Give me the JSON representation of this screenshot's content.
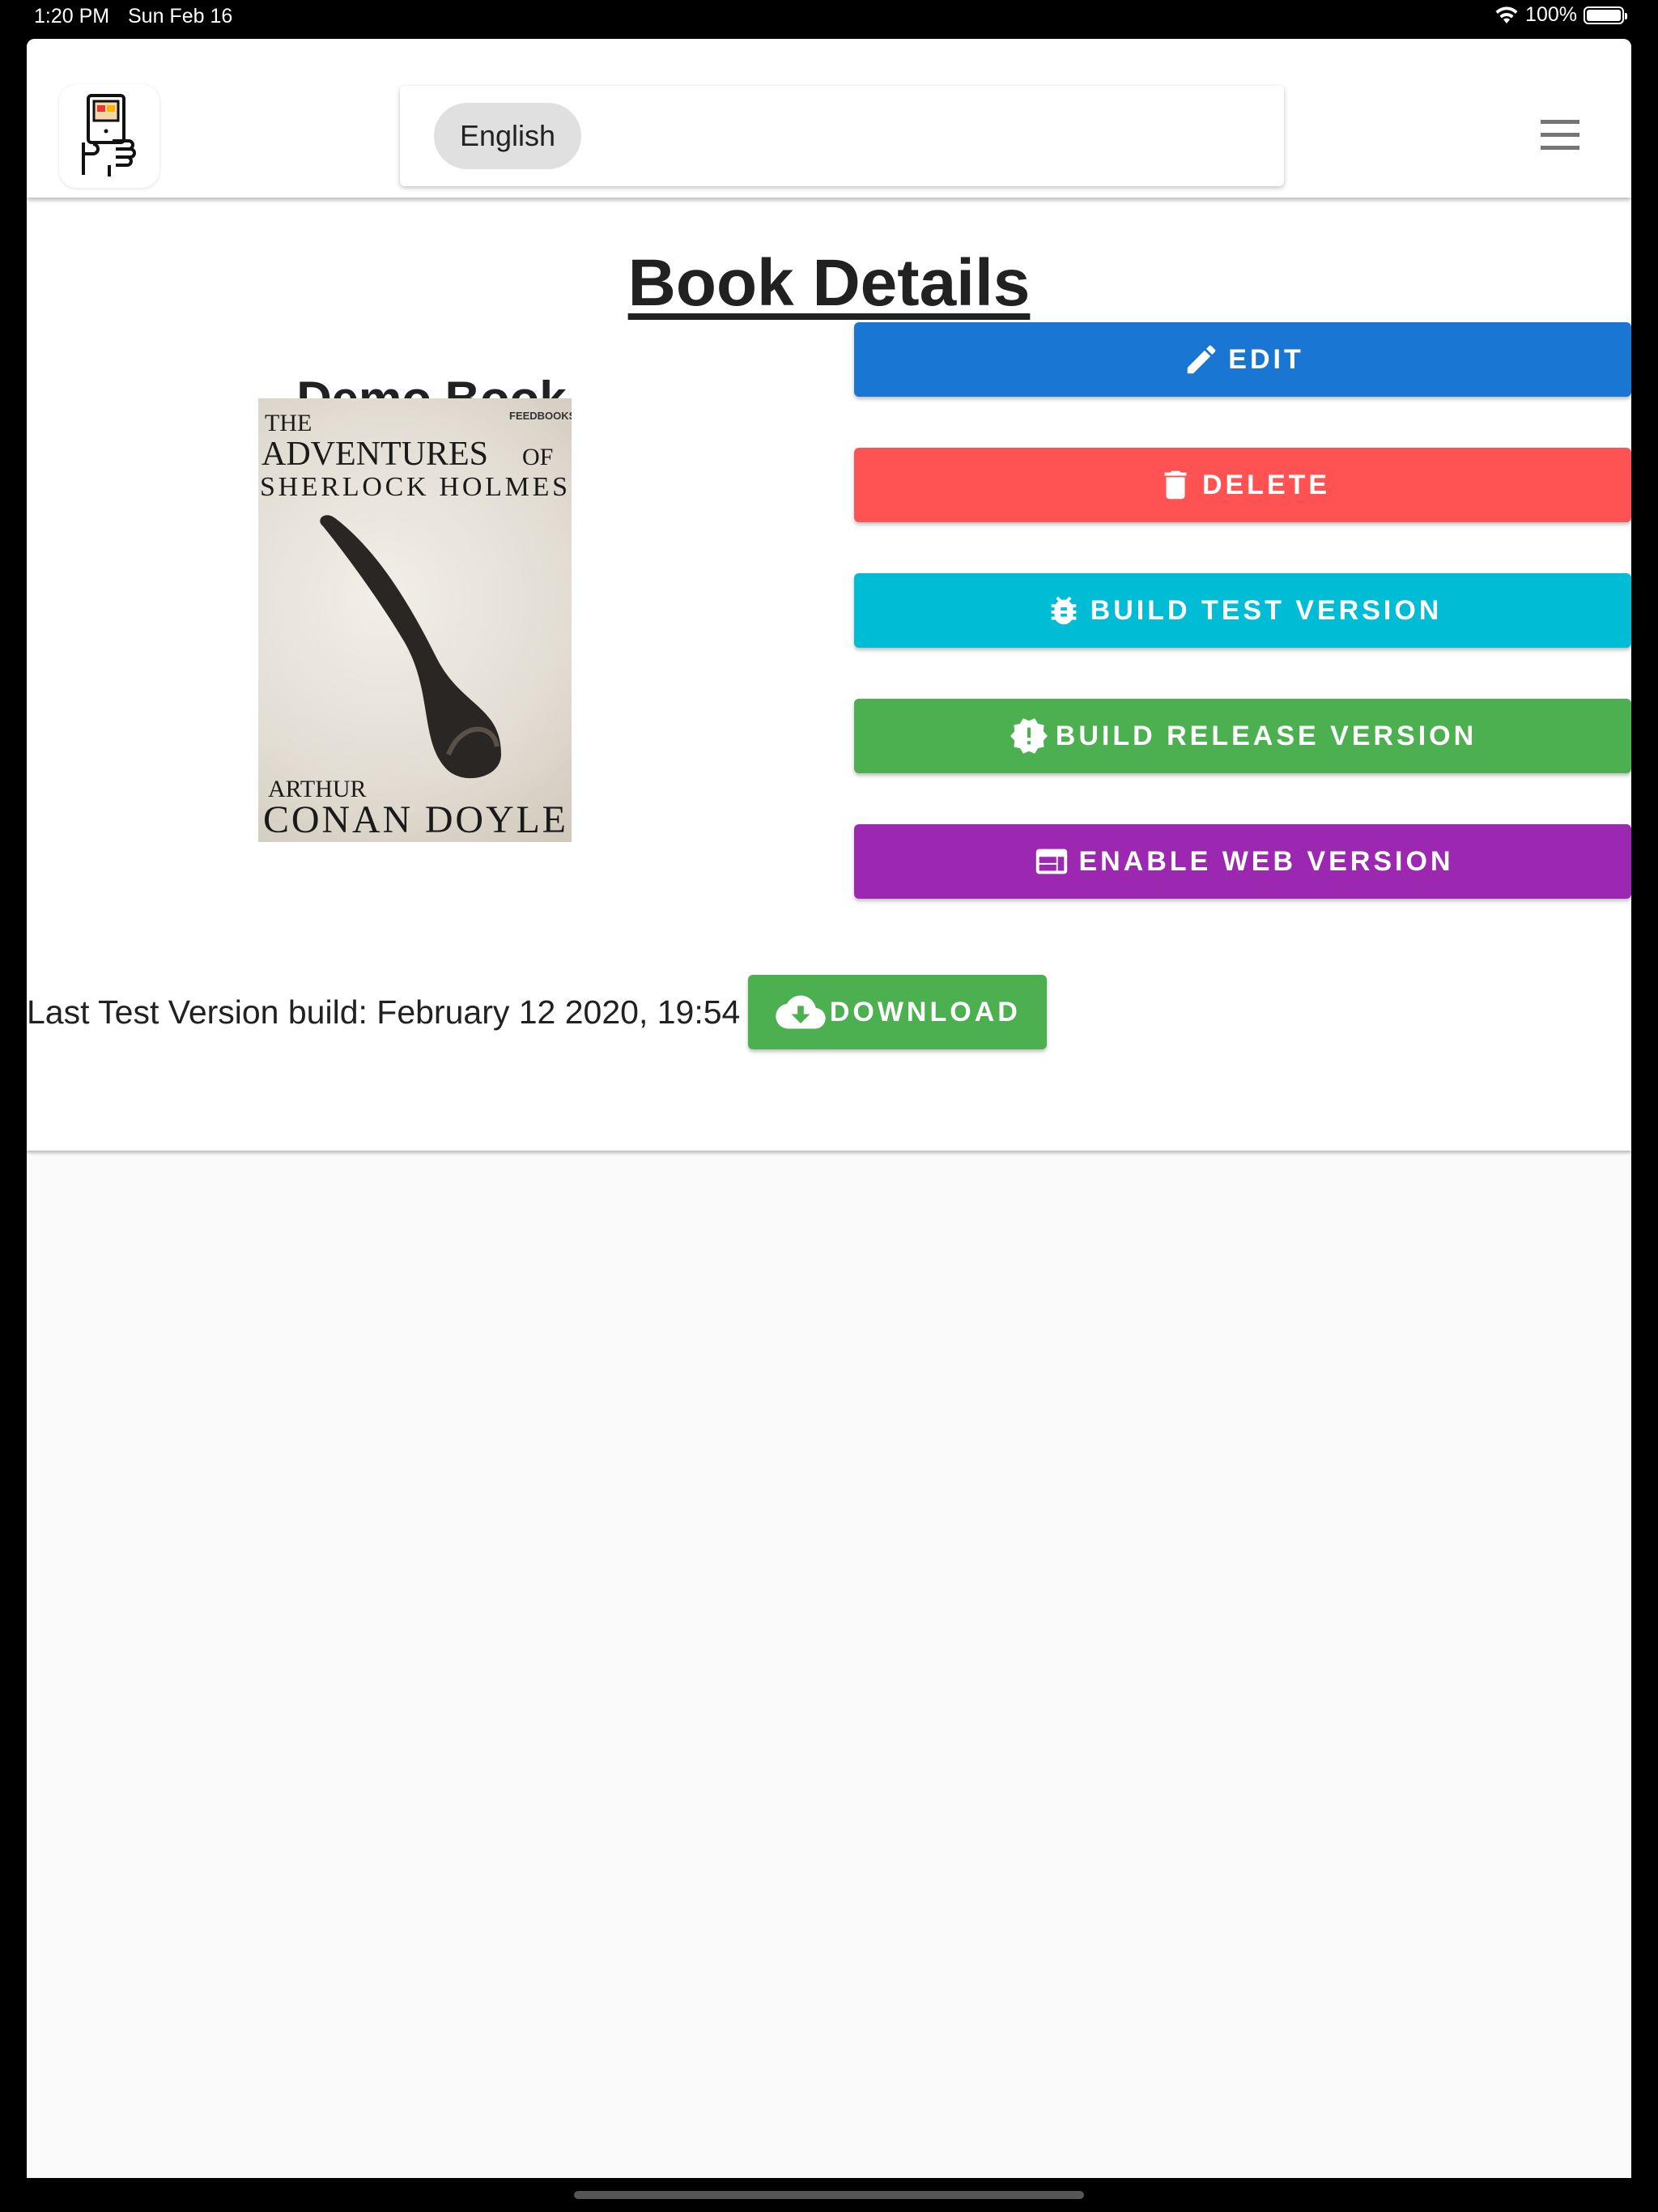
{
  "status_bar": {
    "time": "1:20 PM",
    "date": "Sun Feb 16",
    "battery": "100%"
  },
  "header": {
    "language_chip": "English",
    "menu_icon": "hamburger-menu-icon",
    "logo_icon": "handheld-reader-logo-icon"
  },
  "page": {
    "title": "Book Details"
  },
  "book": {
    "title": "Demo Book",
    "cover": {
      "line1": "THE",
      "publisher": "FEEDBOOKS",
      "line2": "ADVENTURES",
      "line2b": "OF",
      "line3": "SHERLOCK HOLMES",
      "author1": "ARTHUR",
      "author2": "CONAN DOYLE"
    }
  },
  "actions": [
    {
      "label": "EDIT",
      "icon": "pencil-icon",
      "color": "#1976d2"
    },
    {
      "label": "DELETE",
      "icon": "trash-icon",
      "color": "#ff5252"
    },
    {
      "label": "BUILD TEST VERSION",
      "icon": "bug-icon",
      "color": "#00bcd4"
    },
    {
      "label": "BUILD RELEASE VERSION",
      "icon": "alert-decagram-icon",
      "color": "#4caf50"
    },
    {
      "label": "ENABLE WEB VERSION",
      "icon": "web-browser-icon",
      "color": "#9c27b0"
    }
  ],
  "build_info": {
    "text": "Last Test Version build: February 12 2020, 19:54",
    "download_label": "DOWNLOAD",
    "download_icon": "cloud-download-icon"
  }
}
